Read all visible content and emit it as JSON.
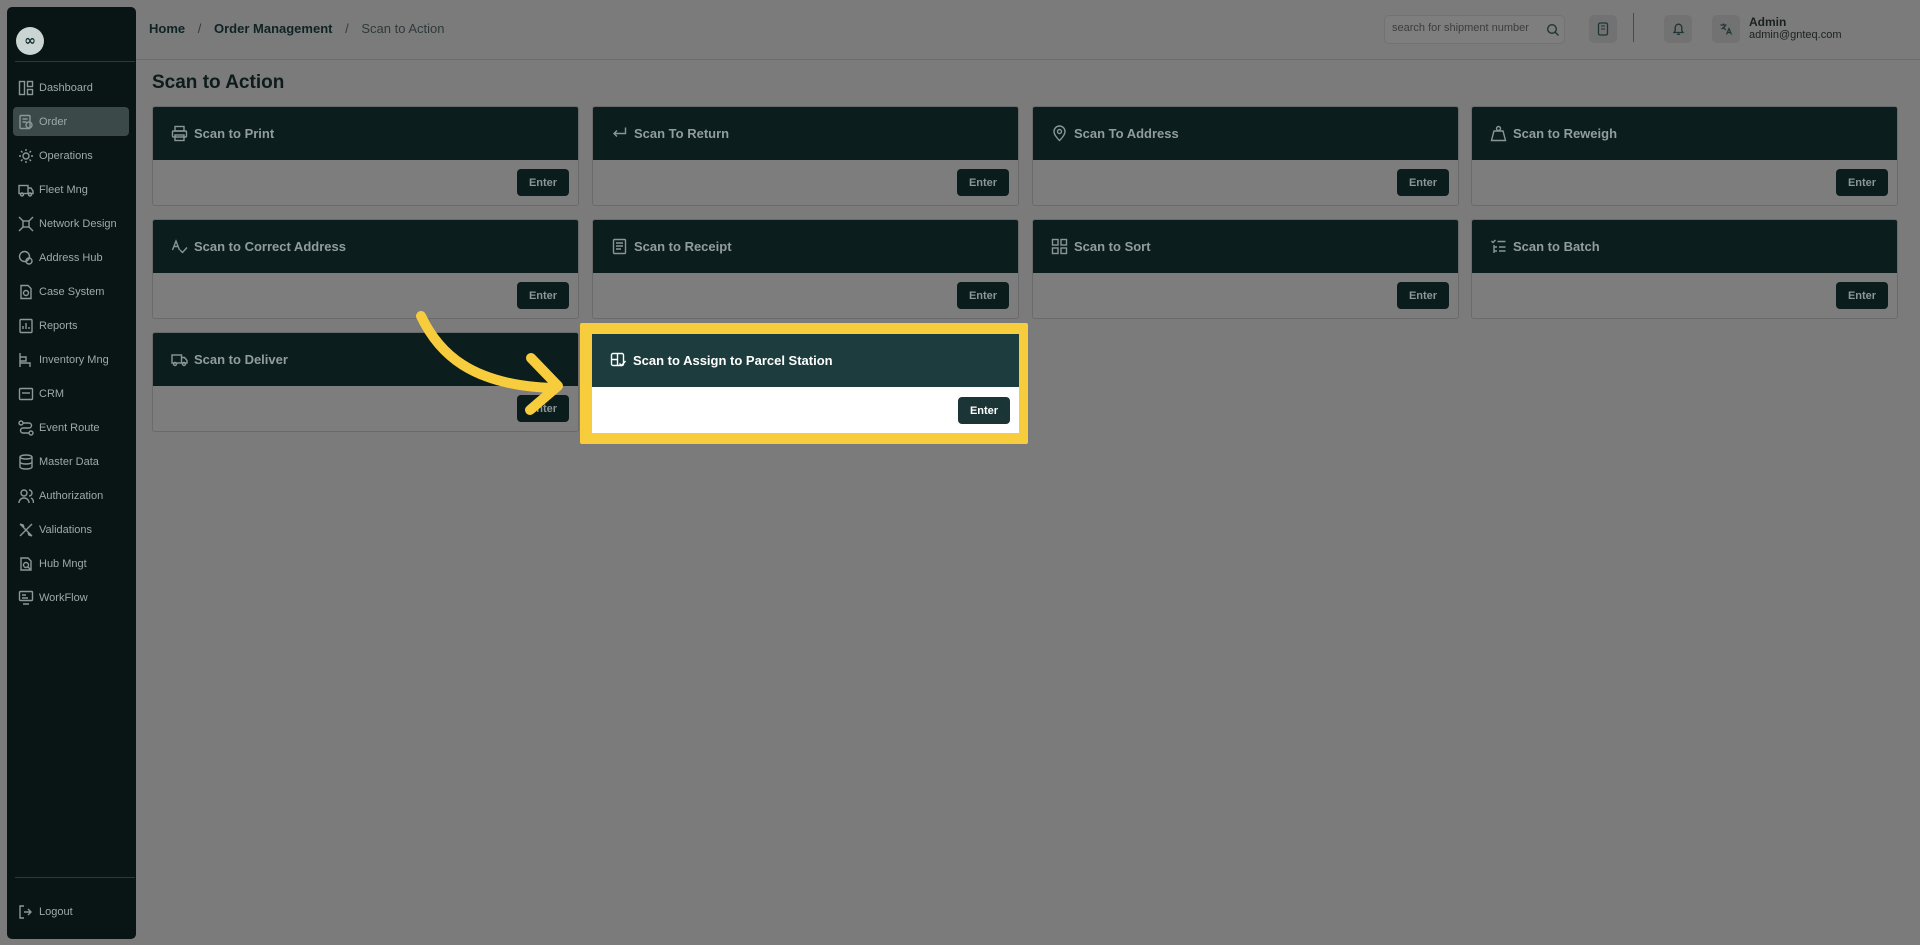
{
  "logo": {
    "text": "∞"
  },
  "sidebar": {
    "items": [
      {
        "label": "Dashboard",
        "icon": "dashboard-icon"
      },
      {
        "label": "Order",
        "icon": "order-icon",
        "active": true
      },
      {
        "label": "Operations",
        "icon": "operations-icon"
      },
      {
        "label": "Fleet Mng",
        "icon": "truck-icon"
      },
      {
        "label": "Network Design",
        "icon": "network-icon"
      },
      {
        "label": "Address Hub",
        "icon": "address-icon"
      },
      {
        "label": "Case System",
        "icon": "case-icon"
      },
      {
        "label": "Reports",
        "icon": "reports-icon"
      },
      {
        "label": "Inventory Mng",
        "icon": "inventory-icon"
      },
      {
        "label": "CRM",
        "icon": "crm-icon"
      },
      {
        "label": "Event Route",
        "icon": "route-icon"
      },
      {
        "label": "Master Data",
        "icon": "database-icon"
      },
      {
        "label": "Authorization",
        "icon": "users-icon"
      },
      {
        "label": "Validations",
        "icon": "tools-icon"
      },
      {
        "label": "Hub Mngt",
        "icon": "hub-icon"
      },
      {
        "label": "WorkFlow",
        "icon": "workflow-icon"
      }
    ],
    "logout": "Logout"
  },
  "header": {
    "breadcrumb": [
      "Home",
      "Order Management",
      "Scan to Action"
    ],
    "separator": "/",
    "search_placeholder": "search for shipment number",
    "user_name": "Admin",
    "user_email": "admin@gnteq.com"
  },
  "main": {
    "title": "Scan to Action",
    "enter_label": "Enter",
    "cards": [
      {
        "label": "Scan to Print",
        "icon": "printer-icon"
      },
      {
        "label": "Scan To Return",
        "icon": "return-icon"
      },
      {
        "label": "Scan To Address",
        "icon": "map-pin-icon"
      },
      {
        "label": "Scan to Reweigh",
        "icon": "weight-icon"
      },
      {
        "label": "Scan to Correct Address",
        "icon": "spellcheck-icon"
      },
      {
        "label": "Scan to Receipt",
        "icon": "receipt-icon"
      },
      {
        "label": "Scan to Sort",
        "icon": "grid-icon"
      },
      {
        "label": "Scan to Batch",
        "icon": "list-check-icon"
      },
      {
        "label": "Scan to Deliver",
        "icon": "delivery-truck-icon"
      },
      {
        "label": "Scan to Assign to Parcel Station",
        "icon": "parcel-station-icon",
        "highlighted": true
      }
    ]
  },
  "colors": {
    "highlight_frame": "#f7cd3e",
    "card_header": "#1d3c3e",
    "overlay": "#7b7b7b"
  }
}
